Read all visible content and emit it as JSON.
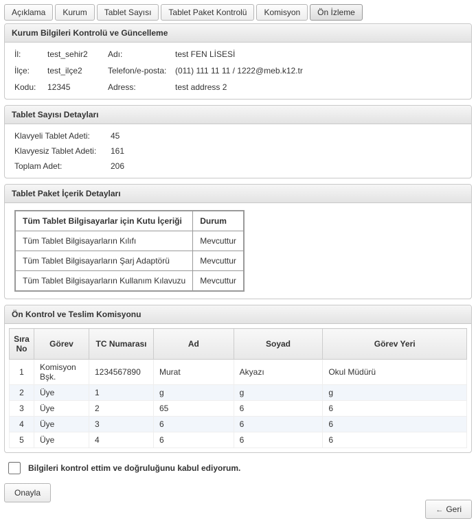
{
  "tabs": {
    "aciklama": "Açıklama",
    "kurum": "Kurum",
    "tabletSayisi": "Tablet Sayısı",
    "tabletPaket": "Tablet Paket Kontrolü",
    "komisyon": "Komisyon",
    "onIzleme": "Ön İzleme"
  },
  "kurumPanel": {
    "title": "Kurum Bilgileri Kontrolü ve Güncelleme",
    "ilLabel": "İl:",
    "il": "test_sehir2",
    "adiLabel": "Adı:",
    "adi": "test FEN LİSESİ",
    "ilceLabel": "İlçe:",
    "ilce": "test_ilçe2",
    "telLabel": "Telefon/e-posta:",
    "tel": "(011) 111 11 11 / 1222@meb.k12.tr",
    "koduLabel": "Kodu:",
    "kodu": "12345",
    "adresLabel": "Adress:",
    "adres": "test address 2"
  },
  "tabletSayisiPanel": {
    "title": "Tablet Sayısı Detayları",
    "klavyeliLabel": "Klavyeli Tablet Adeti:",
    "klavyeli": "45",
    "klavyesizLabel": "Klavyesiz Tablet Adeti:",
    "klavyesiz": "161",
    "toplamLabel": "Toplam Adet:",
    "toplam": "206"
  },
  "paketPanel": {
    "title": "Tablet Paket İçerik Detayları",
    "colContent": "Tüm Tablet Bilgisayarlar için Kutu İçeriği",
    "colStatus": "Durum",
    "rows": [
      {
        "name": "Tüm Tablet Bilgisayarların Kılıfı",
        "status": "Mevcuttur"
      },
      {
        "name": "Tüm Tablet Bilgisayarların Şarj Adaptörü",
        "status": "Mevcuttur"
      },
      {
        "name": "Tüm Tablet Bilgisayarların Kullanım Kılavuzu",
        "status": "Mevcuttur"
      }
    ]
  },
  "komisyonPanel": {
    "title": "Ön Kontrol ve Teslim Komisyonu",
    "headers": {
      "no": "Sıra\nNo",
      "gorev": "Görev",
      "tc": "TC Numarası",
      "ad": "Ad",
      "soyad": "Soyad",
      "yer": "Görev Yeri"
    },
    "rows": [
      {
        "no": "1",
        "gorev": "Komisyon Bşk.",
        "tc": "1234567890",
        "ad": "Murat",
        "soyad": "Akyazı",
        "yer": "Okul Müdürü"
      },
      {
        "no": "2",
        "gorev": "Üye",
        "tc": "1",
        "ad": "g",
        "soyad": "g",
        "yer": "g"
      },
      {
        "no": "3",
        "gorev": "Üye",
        "tc": "2",
        "ad": "65",
        "soyad": "6",
        "yer": "6"
      },
      {
        "no": "4",
        "gorev": "Üye",
        "tc": "3",
        "ad": "6",
        "soyad": "6",
        "yer": "6"
      },
      {
        "no": "5",
        "gorev": "Üye",
        "tc": "4",
        "ad": "6",
        "soyad": "6",
        "yer": "6"
      }
    ]
  },
  "confirm": {
    "label": "Bilgileri kontrol ettim ve doğruluğunu kabul ediyorum."
  },
  "buttons": {
    "onayla": "Onayla",
    "geri": "Geri"
  }
}
